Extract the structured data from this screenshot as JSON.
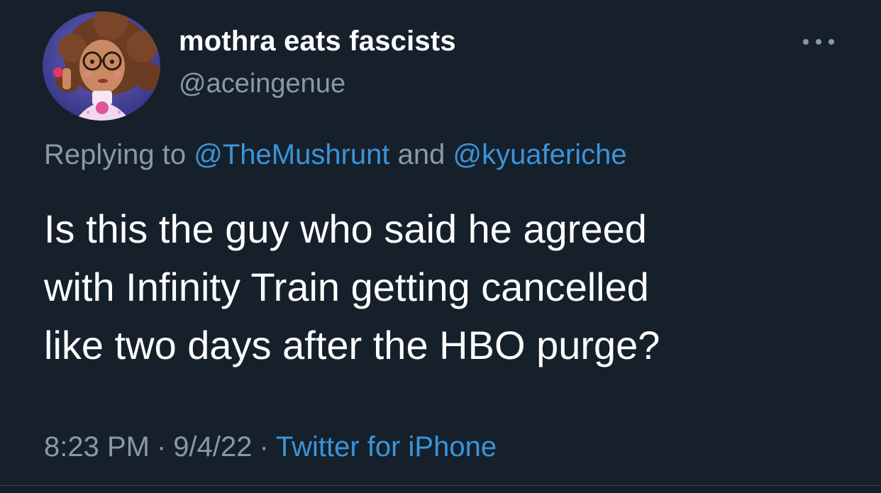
{
  "tweet": {
    "author": {
      "display_name": "mothra eats fascists",
      "handle": "@aceingenue",
      "avatar_icon": "illustrated-portrait-avatar"
    },
    "more_icon": "more-horizontal-icon",
    "reply": {
      "prefix": "Replying to ",
      "mention_1": "@TheMushrunt",
      "joiner": " and ",
      "mention_2": "@kyuaferiche"
    },
    "text_lines": [
      "Is this the guy who said he agreed",
      "with Infinity Train getting cancelled",
      "like two days after the HBO purge?"
    ],
    "meta": {
      "time": "8:23 PM",
      "separator": "·",
      "date": "9/4/22",
      "source": "Twitter for iPhone"
    }
  },
  "colors": {
    "background": "#15202b",
    "primary_text": "#ffffff",
    "secondary_text": "#8b98a5",
    "link": "#3b94d9"
  }
}
